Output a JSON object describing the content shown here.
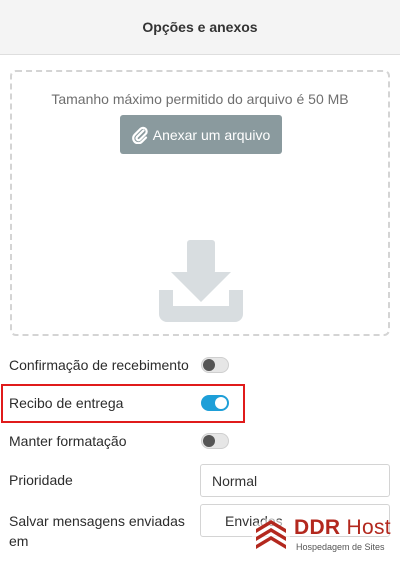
{
  "header": {
    "title": "Opções e anexos"
  },
  "attachments": {
    "hint": "Tamanho máximo permitido do arquivo é 50 MB",
    "attach_label": "Anexar um arquivo",
    "icon": "download-icon"
  },
  "options": {
    "read_receipt": {
      "label": "Confirmação de recebimento",
      "enabled": false
    },
    "delivery_receipt": {
      "label": "Recibo de entrega",
      "enabled": true
    },
    "keep_formatting": {
      "label": "Manter formatação",
      "enabled": false
    },
    "priority": {
      "label": "Prioridade",
      "value": "Normal"
    },
    "save_sent": {
      "label_line1": "Salvar mensagens enviadas",
      "label_line2": "em",
      "value": "Enviados"
    }
  },
  "watermark": {
    "brand": "DDR",
    "brand_suffix": "Host",
    "tagline": "Hospedagem de Sites"
  },
  "colors": {
    "toggle_on": "#1e9fd8",
    "highlight": "#e01b1b",
    "button": "#8a9a9e",
    "brand": "#b3281e"
  }
}
